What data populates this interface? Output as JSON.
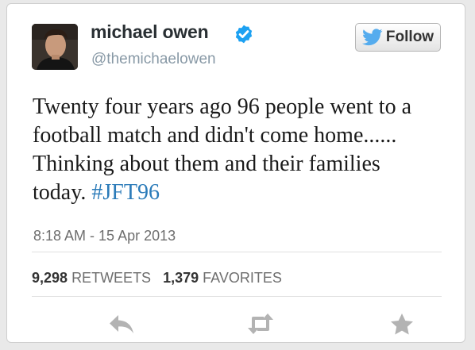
{
  "user": {
    "name": "michael owen",
    "handle": "@themichaelowen",
    "verified": true
  },
  "follow_button": {
    "label": "Follow"
  },
  "tweet": {
    "text": "Twenty four years ago 96 people went to a football match and didn't come home...... Thinking about them and their families today. ",
    "hashtag": "#JFT96",
    "timestamp": "8:18 AM - 15 Apr 2013"
  },
  "stats": {
    "retweets_count": "9,298",
    "retweets_label": "RETWEETS",
    "favorites_count": "1,379",
    "favorites_label": "FAVORITES"
  },
  "actions": [
    {
      "name": "reply",
      "icon": "reply-icon"
    },
    {
      "name": "retweet",
      "icon": "retweet-icon"
    },
    {
      "name": "favorite",
      "icon": "star-icon"
    }
  ],
  "colors": {
    "verified_badge": "#1da1f2",
    "twitter_bird": "#55acee",
    "hashtag": "#2b7bb9",
    "action_icons": "#b3b3b3"
  }
}
